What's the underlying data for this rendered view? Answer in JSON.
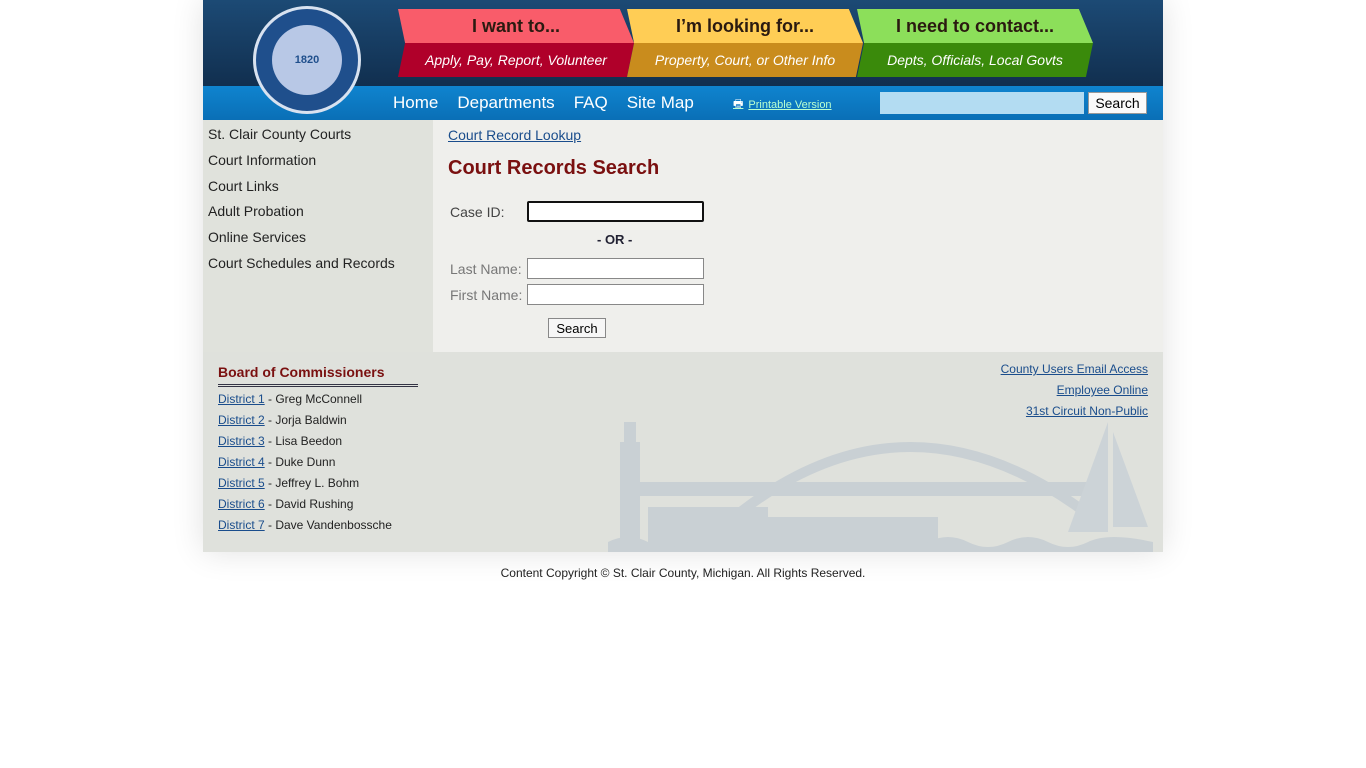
{
  "header": {
    "logo_text": "Saint Clair County Michigan 1820",
    "banners": [
      {
        "title": "I want to...",
        "subtitle": "Apply, Pay, Report, Volunteer",
        "top": "#f95c6a",
        "bottom": "#b0002a"
      },
      {
        "title": "I’m looking for...",
        "subtitle": "Property, Court, or Other Info",
        "top": "#ffcd55",
        "bottom": "#c98c1d"
      },
      {
        "title": "I need to contact...",
        "subtitle": "Depts, Officials, Local Govts",
        "top": "#8cdf5a",
        "bottom": "#3a8a0b"
      }
    ]
  },
  "nav": {
    "items": [
      "Home",
      "Departments",
      "FAQ",
      "Site Map"
    ],
    "printable": "Printable Version",
    "search_value": "",
    "search_button": "Search"
  },
  "sidebar": {
    "items": [
      "St. Clair County Courts",
      "Court Information",
      "Court Links",
      "Adult Probation",
      "Online Services",
      "Court Schedules and Records"
    ]
  },
  "main": {
    "breadcrumb": "Court Record Lookup",
    "title": "Court Records Search",
    "case_id_label": "Case ID:",
    "or": "- OR -",
    "last_name_label": "Last Name:",
    "first_name_label": "First Name:",
    "search_button": "Search"
  },
  "footer": {
    "board_title": "Board of Commissioners",
    "districts": [
      {
        "d": "District 1",
        "n": " - Greg McConnell"
      },
      {
        "d": "District 2",
        "n": " - Jorja Baldwin"
      },
      {
        "d": "District 3",
        "n": " - Lisa Beedon"
      },
      {
        "d": "District 4",
        "n": " - Duke Dunn"
      },
      {
        "d": "District 5",
        "n": " - Jeffrey L. Bohm"
      },
      {
        "d": "District 6",
        "n": " - David Rushing"
      },
      {
        "d": "District 7",
        "n": " - Dave Vandenbossche"
      }
    ],
    "links": [
      "County Users Email Access",
      "Employee Online",
      "31st Circuit Non-Public"
    ],
    "copyright": "Content Copyright © St. Clair County, Michigan.  All Rights Reserved."
  }
}
